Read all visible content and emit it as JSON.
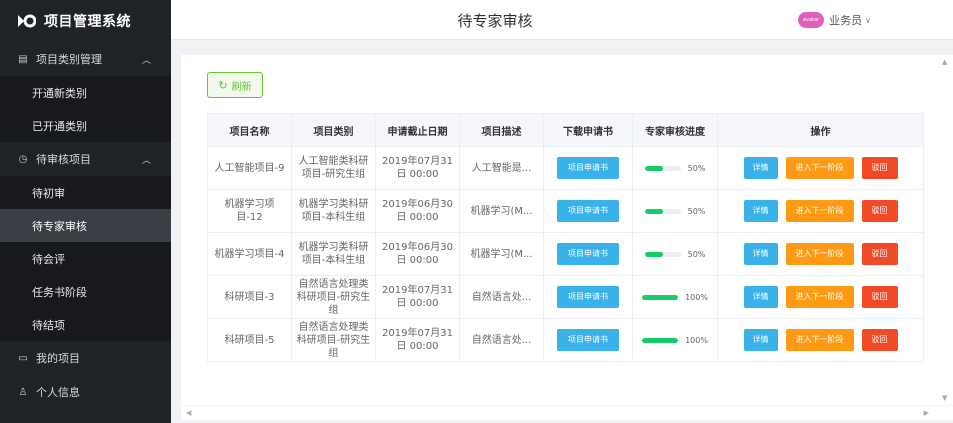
{
  "app": {
    "title": "项目管理系统"
  },
  "header": {
    "title": "待专家审核",
    "user_name": "业务员",
    "avatar_text": "avatar"
  },
  "sidebar": {
    "groups": [
      {
        "label": "项目类别管理",
        "icon": "list-icon",
        "items": [
          {
            "label": "开通新类别"
          },
          {
            "label": "已开通类别"
          }
        ]
      },
      {
        "label": "待审核项目",
        "icon": "clock-icon",
        "items": [
          {
            "label": "待初审"
          },
          {
            "label": "待专家审核",
            "active": true
          },
          {
            "label": "待会评"
          },
          {
            "label": "任务书阶段"
          },
          {
            "label": "待结项"
          }
        ]
      },
      {
        "label": "我的项目",
        "icon": "folder-icon",
        "items": []
      },
      {
        "label": "个人信息",
        "icon": "user-icon",
        "items": []
      }
    ]
  },
  "toolbar": {
    "refresh_label": "刷新"
  },
  "table": {
    "headers": [
      "项目名称",
      "项目类别",
      "申请截止日期",
      "项目描述",
      "下载申请书",
      "专家审核进度",
      "操作"
    ],
    "download_label": "项目申请书",
    "actions": {
      "detail": "详情",
      "next": "进入下一阶段",
      "back": "驳回"
    },
    "rows": [
      {
        "name": "人工智能项目-9",
        "category": "人工智能类科研项目-研究生组",
        "deadline": "2019年07月31日 00:00",
        "desc": "人工智能是...",
        "progress": 0.5,
        "progress_label": "50%"
      },
      {
        "name": "机器学习项目-12",
        "category": "机器学习类科研项目-本科生组",
        "deadline": "2019年06月30日 00:00",
        "desc": "机器学习(M...",
        "progress": 0.5,
        "progress_label": "50%"
      },
      {
        "name": "机器学习项目-4",
        "category": "机器学习类科研项目-本科生组",
        "deadline": "2019年06月30日 00:00",
        "desc": "机器学习(M...",
        "progress": 0.5,
        "progress_label": "50%"
      },
      {
        "name": "科研项目-3",
        "category": "自然语言处理类科研项目-研究生组",
        "deadline": "2019年07月31日 00:00",
        "desc": "自然语言处...",
        "progress": 1.0,
        "progress_label": "100%"
      },
      {
        "name": "科研项目-5",
        "category": "自然语言处理类科研项目-研究生组",
        "deadline": "2019年07月31日 00:00",
        "desc": "自然语言处...",
        "progress": 1.0,
        "progress_label": "100%"
      }
    ]
  },
  "colors": {
    "accent": "#3ab1e9",
    "warning": "#ff9a14",
    "danger": "#f04b26",
    "success": "#13ce66",
    "sidebar_bg": "#1f2227"
  }
}
